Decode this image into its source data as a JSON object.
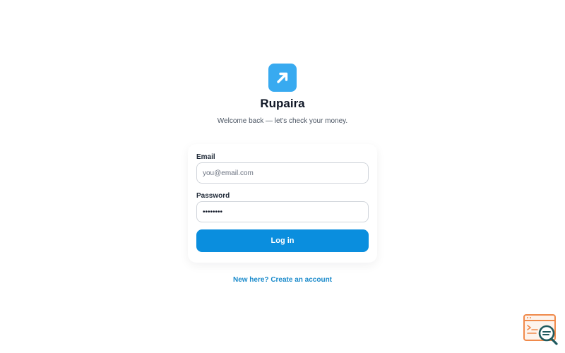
{
  "app": {
    "name": "Rupaira",
    "subtitle": "Welcome back — let's check your money.",
    "logo_icon": "arrow-up-right-icon"
  },
  "form": {
    "email_label": "Email",
    "email_placeholder": "you@email.com",
    "email_value": "",
    "password_label": "Password",
    "password_value": "••••••••",
    "login_label": "Log in"
  },
  "footer": {
    "signup_link": "New here? Create an account"
  },
  "widget": {
    "icon": "console-search-icon"
  },
  "colors": {
    "brand": "#38aaf0",
    "primary_button": "#0a8ede",
    "link": "#1a8acb",
    "widget_orange": "#f08a4b",
    "widget_teal": "#1f5a5f"
  }
}
